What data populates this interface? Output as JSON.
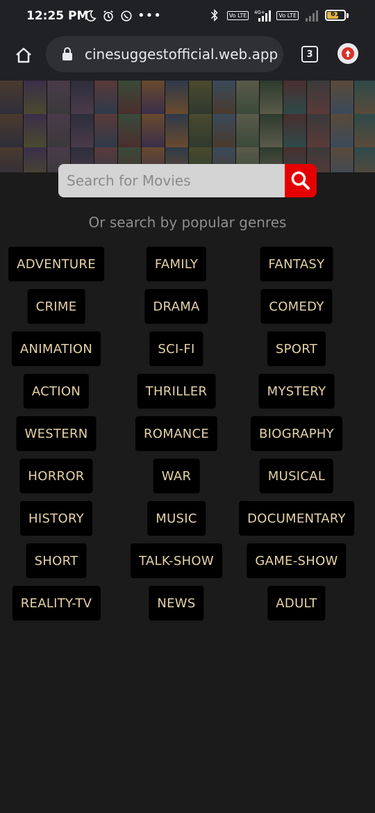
{
  "status": {
    "time": "12:25 PM",
    "battery": "61",
    "volte1": "Vo LTE",
    "volte2": "Vo LTE",
    "network": "4G+"
  },
  "browser": {
    "url": "cinesuggestofficial.web.app",
    "tab_count": "3"
  },
  "search": {
    "placeholder": "Search for Movies"
  },
  "genre_label": "Or search by popular genres",
  "genres": [
    [
      "ADVENTURE",
      "FAMILY",
      "FANTASY"
    ],
    [
      "CRIME",
      "DRAMA",
      "COMEDY"
    ],
    [
      "ANIMATION",
      "SCI-FI",
      "SPORT"
    ],
    [
      "ACTION",
      "THRILLER",
      "MYSTERY"
    ],
    [
      "WESTERN",
      "ROMANCE",
      "BIOGRAPHY"
    ],
    [
      "HORROR",
      "WAR",
      "MUSICAL"
    ],
    [
      "HISTORY",
      "MUSIC",
      "DOCUMENTARY"
    ],
    [
      "SHORT",
      "TALK-SHOW",
      "GAME-SHOW"
    ],
    [
      "REALITY-TV",
      "NEWS",
      "ADULT"
    ]
  ],
  "colors": {
    "background": "#1b1b1b",
    "genre_text": "#e5d2a6",
    "search_button": "#e50000",
    "browser_bar": "#202124"
  }
}
